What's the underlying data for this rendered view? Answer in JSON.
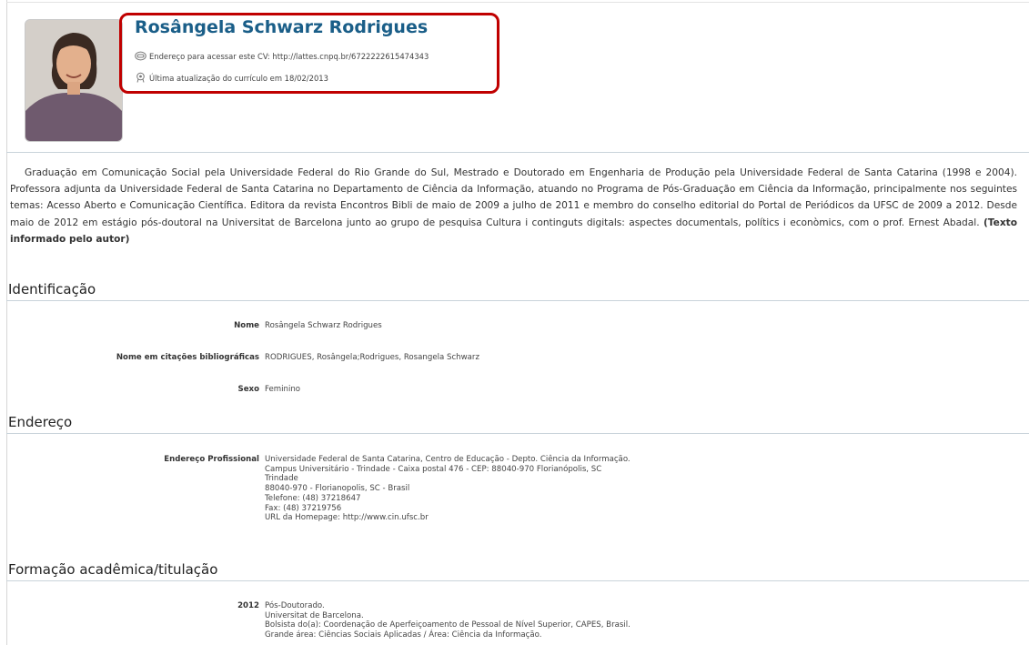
{
  "profile": {
    "name": "Rosângela Schwarz Rodrigues",
    "cv_address": "Endereço para acessar este CV: http://lattes.cnpq.br/6722222615474343",
    "last_update": "Última atualização do currículo em 18/02/2013"
  },
  "summary": {
    "text": "Graduação em Comunicação Social pela Universidade Federal do Rio Grande do Sul, Mestrado e Doutorado em Engenharia de Produção pela Universidade Federal de Santa Catarina (1998 e 2004). Professora adjunta da Universidade Federal de Santa Catarina no Departamento de Ciência da Informação, atuando no Programa de Pós-Graduação em Ciência da Informação, principalmente nos seguintes temas: Acesso Aberto e Comunicação Científica. Editora da revista Encontros Bibli de maio de 2009 a julho de 2011 e membro do conselho editorial do Portal de Periódicos da UFSC de 2009 a 2012. Desde maio de 2012 em estágio pós-doutoral na Universitat de Barcelona junto ao grupo de pesquisa Cultura i continguts digitals: aspectes documentals, polítics i econòmics, com o prof. Ernest Abadal.",
    "source_note": "(Texto informado pelo autor)"
  },
  "sections": {
    "identificacao": {
      "title": "Identificação",
      "rows": [
        {
          "label": "Nome",
          "value": "Rosângela Schwarz Rodrigues"
        },
        {
          "label": "Nome em citações bibliográficas",
          "value": "RODRIGUES, Rosângela;Rodrigues, Rosangela Schwarz"
        },
        {
          "label": "Sexo",
          "value": "Feminino"
        }
      ]
    },
    "endereco": {
      "title": "Endereço",
      "label": "Endereço Profissional",
      "lines": [
        "Universidade Federal de Santa Catarina, Centro de Educação - Depto. Ciência da Informação.",
        "Campus Universitário - Trindade - Caixa postal 476 - CEP: 88040-970 Florianópolis, SC",
        "Trindade",
        "88040-970 - Florianopolis, SC - Brasil",
        "Telefone: (48) 37218647",
        "Fax: (48) 37219756",
        "URL da Homepage: http://www.cin.ufsc.br"
      ]
    },
    "formacao": {
      "title": "Formação acadêmica/titulação",
      "year": "2012",
      "lines": [
        "Pós-Doutorado.",
        "Universitat de Barcelona.",
        "Bolsista do(a): Coordenação de Aperfeiçoamento de Pessoal de Nível Superior, CAPES, Brasil.",
        "Grande área: Ciências Sociais Aplicadas / Área: Ciência da Informação."
      ]
    }
  },
  "colors": {
    "name": "#1a5e88",
    "highlight_border": "#c00000",
    "section_rule": "#c9d3da"
  },
  "icons": [
    "link-icon",
    "update-badge-icon"
  ]
}
